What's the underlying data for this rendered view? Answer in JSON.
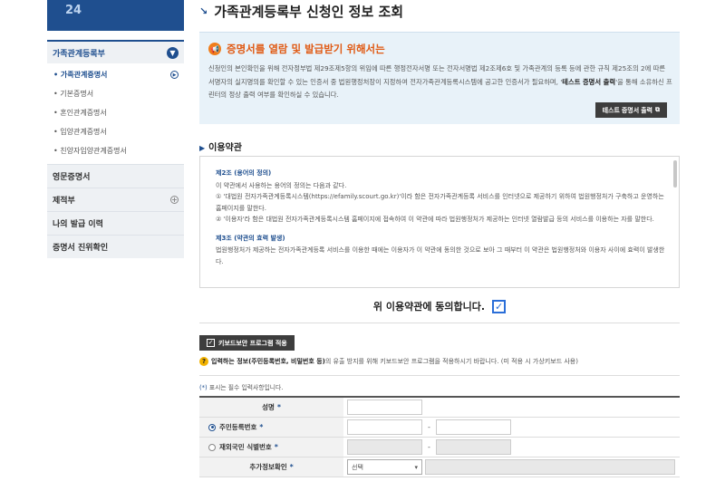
{
  "sidebar": {
    "banner_text": "24",
    "section_title": "가족관계등록부",
    "sub_items": [
      {
        "label": "• 가족관계증명서",
        "active": true
      },
      {
        "label": "• 기본증명서",
        "active": false
      },
      {
        "label": "• 혼인관계증명서",
        "active": false
      },
      {
        "label": "• 입양관계증명서",
        "active": false
      },
      {
        "label": "• 친양자입양관계증명서",
        "active": false
      }
    ],
    "main_items": [
      {
        "label": "영문증명서",
        "expandable": false
      },
      {
        "label": "제적부",
        "expandable": true
      },
      {
        "label": "나의 발급 이력",
        "expandable": false
      },
      {
        "label": "증명서 진위확인",
        "expandable": false
      }
    ]
  },
  "page": {
    "title": "가족관계등록부 신청인 정보 조회"
  },
  "notice": {
    "title": "증명서를 열람 및 발급받기 위해서는",
    "body_1": "신청인의 본인확인을 위해 전자정부법 제29조제5항의 위임에 따른 행정전자서명 또는 전자서명법 제2조제6호 및 가족관계의 등록 등에 관한 규칙 제25조의 2에 따른 서명자의 실지명의를 확인할 수 있는 인증서 중 법원행정처장이 지정하여 전자가족관계등록시스템에 공고한 인증서가 필요하며, '",
    "body_bold": "테스트 증명서 출력",
    "body_2": "'을 통해 소유하신 프린터의 정상 출력 여부를 확인하실 수 있습니다.",
    "test_button": "테스트 증명서 출력"
  },
  "terms": {
    "heading": "이용약관",
    "art2_title": "제2조 (용어의 정의)",
    "art2_intro": "이 약관에서 사용하는 용어의 정의는 다음과 같다.",
    "art2_item1": "① '대법원 전자가족관계등록시스템(https://efamily.scourt.go.kr)'이라 함은 전자가족관계등록 서비스를 인터넷으로 제공하기 위하여 법원행정처가 구축하고 운영하는 홈페이지를 말한다.",
    "art2_item2": "② '이용자'라 함은 대법원 전자가족관계등록시스템 홈페이지에 접속하여 이 약관에 따라 법원행정처가 제공하는 인터넷 열람발급 등의 서비스를 이용하는 자를 말한다.",
    "art3_title": "제3조 (약관의 효력 발생)",
    "art3_body": "법원행정처가 제공하는 전자가족관계등록 서비스를 이용한 때에는 이용자가 이 약관에 동의한 것으로 보아 그 때부터 이 약관은 법원행정처와 이용자 사이에 효력이 발생한다.",
    "agree_text": "위 이용약관에 동의합니다."
  },
  "keyboard": {
    "button": "키보드보안 프로그램 적용",
    "note_bold": "입력하는 정보(주민등록번호, 비밀번호 등)",
    "note_rest": "의 유출 방지를 위해 키보드보안 프로그램을 적용하시기 바랍니다. (미 적용 시 가상키보드 사용)"
  },
  "form": {
    "required_note_star": "(*)",
    "required_note": " 표시는 필수 입력사항입니다.",
    "rows": [
      {
        "label": "성명",
        "star": "*"
      },
      {
        "label": "주민등록번호",
        "star": "*",
        "radio": true,
        "checked": true
      },
      {
        "label": "재외국민 식별번호",
        "star": "*",
        "radio": true,
        "checked": false
      },
      {
        "label": "추가정보확인",
        "star": "*"
      }
    ],
    "dash": "-",
    "select_value": "선택"
  }
}
